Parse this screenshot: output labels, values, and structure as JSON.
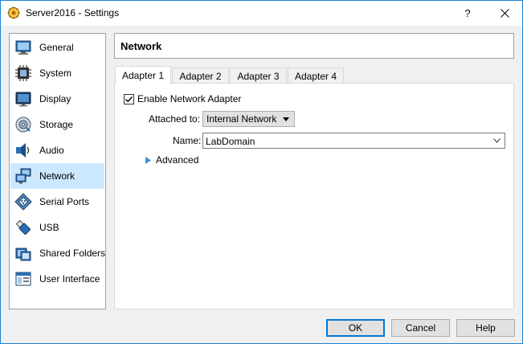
{
  "window": {
    "title": "Server2016 - Settings",
    "help_glyph": "?",
    "close_glyph": "✕"
  },
  "sidebar": {
    "items": [
      {
        "label": "General",
        "icon": "general-icon"
      },
      {
        "label": "System",
        "icon": "system-icon"
      },
      {
        "label": "Display",
        "icon": "display-icon"
      },
      {
        "label": "Storage",
        "icon": "storage-icon"
      },
      {
        "label": "Audio",
        "icon": "audio-icon"
      },
      {
        "label": "Network",
        "icon": "network-icon",
        "selected": true
      },
      {
        "label": "Serial Ports",
        "icon": "serial-ports-icon"
      },
      {
        "label": "USB",
        "icon": "usb-icon"
      },
      {
        "label": "Shared Folders",
        "icon": "shared-folders-icon"
      },
      {
        "label": "User Interface",
        "icon": "user-interface-icon"
      }
    ]
  },
  "header": {
    "title": "Network"
  },
  "tabs": [
    {
      "label": "Adapter 1",
      "active": true
    },
    {
      "label": "Adapter 2"
    },
    {
      "label": "Adapter 3"
    },
    {
      "label": "Adapter 4"
    }
  ],
  "adapter": {
    "enable_label": "Enable Network Adapter",
    "enabled": true,
    "attached_label": "Attached to:",
    "attached_value": "Internal Network",
    "name_label": "Name:",
    "name_value": "LabDomain",
    "advanced_label": "Advanced"
  },
  "buttons": {
    "ok": "OK",
    "cancel": "Cancel",
    "help": "Help"
  },
  "colors": {
    "accent": "#0078d7",
    "selection": "#cce8ff",
    "window_border": "#1883d7"
  }
}
